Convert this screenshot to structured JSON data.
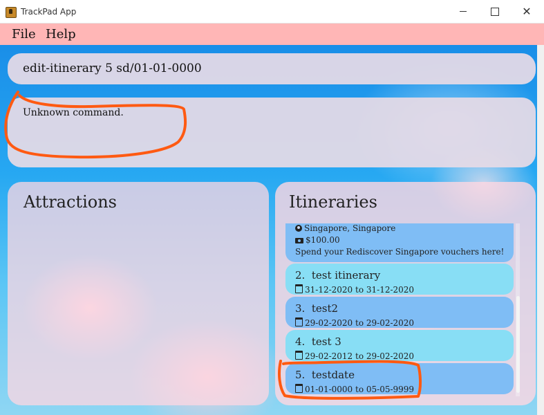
{
  "window": {
    "title": "TrackPad App",
    "minimize": "—",
    "close": "✕"
  },
  "menu": {
    "file": "File",
    "help": "Help"
  },
  "command": {
    "value": "edit-itinerary 5 sd/01-01-0000"
  },
  "result": {
    "message": "Unknown command."
  },
  "attractions": {
    "title": "Attractions"
  },
  "itineraries": {
    "title": "Itineraries",
    "partial_card": {
      "location": "Singapore, Singapore",
      "budget": "$100.00",
      "description": "Spend your Rediscover Singapore vouchers here!"
    },
    "items": [
      {
        "index": "2.",
        "name": "test itinerary",
        "dates": "31-12-2020 to 31-12-2020"
      },
      {
        "index": "3.",
        "name": "test2",
        "dates": "29-02-2020 to 29-02-2020"
      },
      {
        "index": "4.",
        "name": "test 3",
        "dates": "29-02-2012 to 29-02-2020"
      },
      {
        "index": "5.",
        "name": "testdate",
        "dates": "01-01-0000 to 05-05-9999"
      }
    ]
  },
  "colors": {
    "menu_bg": "#ffb6b6",
    "annotation": "#ff5a12",
    "card_blue": "#7fbdf5",
    "card_cyan": "#88def5"
  }
}
